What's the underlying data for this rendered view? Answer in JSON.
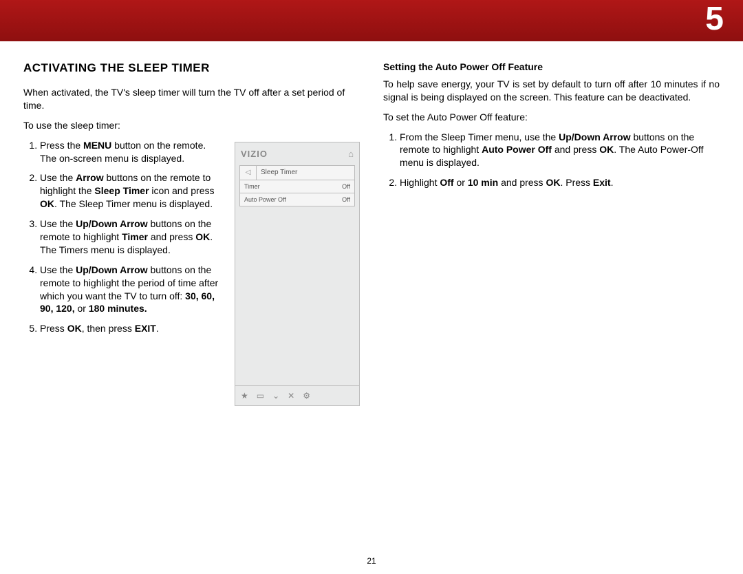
{
  "chapter": "5",
  "page_number": "21",
  "left": {
    "heading": "ACTIVATING THE SLEEP TIMER",
    "intro": "When activated, the TV's sleep timer will turn the TV off after a set period of time.",
    "lead": "To use the sleep timer:",
    "steps": {
      "s1a": "Press the ",
      "s1b": "MENU",
      "s1c": " button on the remote. The on-screen menu is displayed.",
      "s2a": "Use the ",
      "s2b": "Arrow",
      "s2c": " buttons on the remote to highlight the ",
      "s2d": "Sleep Timer",
      "s2e": " icon and press ",
      "s2f": "OK",
      "s2g": ". The Sleep Timer menu is displayed.",
      "s3a": "Use the ",
      "s3b": "Up/Down Arrow",
      "s3c": " buttons on the remote to highlight ",
      "s3d": "Timer",
      "s3e": " and press ",
      "s3f": "OK",
      "s3g": ". The Timers menu is displayed.",
      "s4a": "Use the ",
      "s4b": "Up/Down Arrow",
      "s4c": " buttons on the remote to highlight the period of time after which you want the TV to turn off: ",
      "s4d": "30, 60, 90, 120,",
      "s4e": " or ",
      "s4f": "180 minutes.",
      "s5a": "Press ",
      "s5b": "OK",
      "s5c": ", then press ",
      "s5d": "EXIT",
      "s5e": "."
    }
  },
  "menu": {
    "brand": "VIZIO",
    "title": "Sleep Timer",
    "rows": [
      {
        "label": "Timer",
        "value": "Off"
      },
      {
        "label": "Auto Power Off",
        "value": "Off"
      }
    ],
    "footer_icons": [
      "★",
      "▭",
      "⌄",
      "✕",
      "⚙"
    ]
  },
  "right": {
    "heading": "Setting the Auto Power Off Feature",
    "intro": "To help save energy, your TV is set by default to turn off after 10 minutes if no signal is being displayed on the screen. This feature can be deactivated.",
    "lead": "To set the Auto Power Off feature:",
    "steps": {
      "r1a": "From the Sleep Timer menu, use the ",
      "r1b": "Up/Down Arrow",
      "r1c": " buttons on the remote to highlight ",
      "r1d": "Auto Power Off",
      "r1e": " and press ",
      "r1f": "OK",
      "r1g": ". The Auto Power-Off menu is displayed.",
      "r2a": "Highlight ",
      "r2b": "Off",
      "r2c": " or ",
      "r2d": "10 min",
      "r2e": " and press ",
      "r2f": "OK",
      "r2g": ". Press ",
      "r2h": "Exit",
      "r2i": "."
    }
  }
}
